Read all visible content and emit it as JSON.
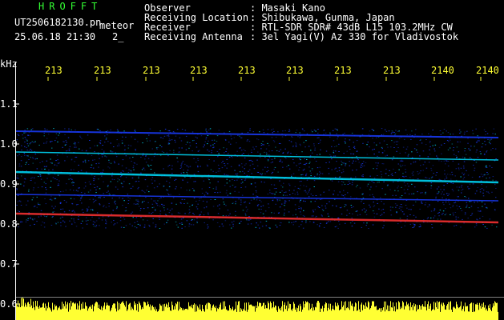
{
  "header": {
    "brand": "HROFFT",
    "filename": "UT2506182130.pn",
    "tag": "meteor",
    "datetime": "25.06.18 21:30",
    "index": "2_",
    "fields": [
      {
        "label": "Observer",
        "value": ": Masaki Kano"
      },
      {
        "label": "Receiving Location",
        "value": ": Shibukawa, Gunma, Japan"
      },
      {
        "label": "Receiver",
        "value": ": RTL-SDR SDR# 43dB L15 103.2MHz CW"
      },
      {
        "label": "Receiving Antenna",
        "value": ": 3el Yagi(V) Az 330 for Vladivostok"
      }
    ]
  },
  "axes": {
    "y_unit": "kHz",
    "y_ticks": [
      "1.1",
      "1.0",
      "0.9",
      "0.8",
      "0.7",
      "0.6"
    ],
    "x_ticks": [
      "213",
      "213",
      "213",
      "213",
      "213",
      "213",
      "213",
      "213",
      "2140"
    ]
  },
  "colors": {
    "background": "#000000",
    "brand": "#33ff33",
    "ticks": "#ffff33",
    "signal_low": "#1a3cff",
    "signal_mid": "#00e0ff",
    "signal_high": "#ff3333"
  }
}
